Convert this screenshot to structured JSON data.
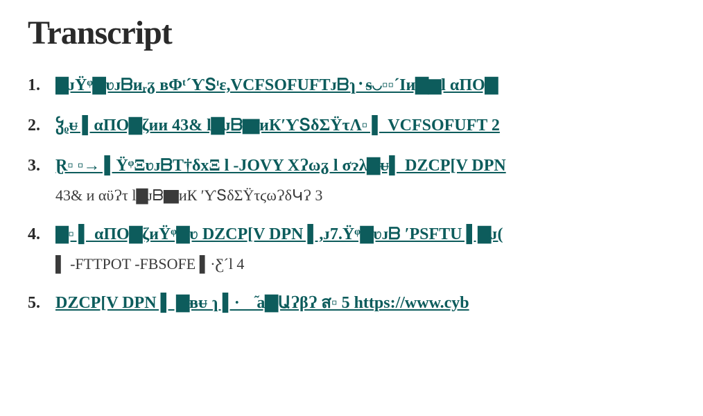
{
  "title": "Transcript",
  "items": [
    {
      "link": "▇ᴊŸᵠ▇ʋᴊᗷиᵣᵹ вΦᵗ´ƳՏᶦε,VCFSOFUFTᴊᗷɿ᛫ᵴ◡▫▫´Iи▇▆l αΠО▇",
      "sub": null
    },
    {
      "link": "ჴᵨᵾ ▌αΠО▇ζии 43& l▇ᴊᗷ▇иК′ƳՏδΣŸτΛ▫ ▌ VCFSOFUFT 2",
      "sub": null
    },
    {
      "link": "Ɽ▫ ▫→ ▌ŸᵠΞʋᴊᗷT†δxΞ l -JOVY XɁωᵹ l σɂλ▇ᵾ▌ DZCP[V DPN",
      "sub": "43& и         αϋɁτ l▇ᴊᗷ▇иК ′ƳՏδΣŸτϛωɁδԿɁ 3"
    },
    {
      "link": "▇▫ ▌ αΠО▇ζиŸᵠ▇ʋ DZCP[V DPN ▌,ᴊ7.Ÿᵠ▇ʋᴊᗷ ′PSFTU ▌▇ᴊ(",
      "sub": "▌ -FTTPOT -FBSOFE ▌·Ƹ´l 4"
    },
    {
      "link": "DZCP[V DPN ▌    ▇ᴃᵾ ɿ ▌· ֍᷉а▇ԱɁβɁ   ส▫ 5 https://www.cyb",
      "sub": null
    }
  ]
}
